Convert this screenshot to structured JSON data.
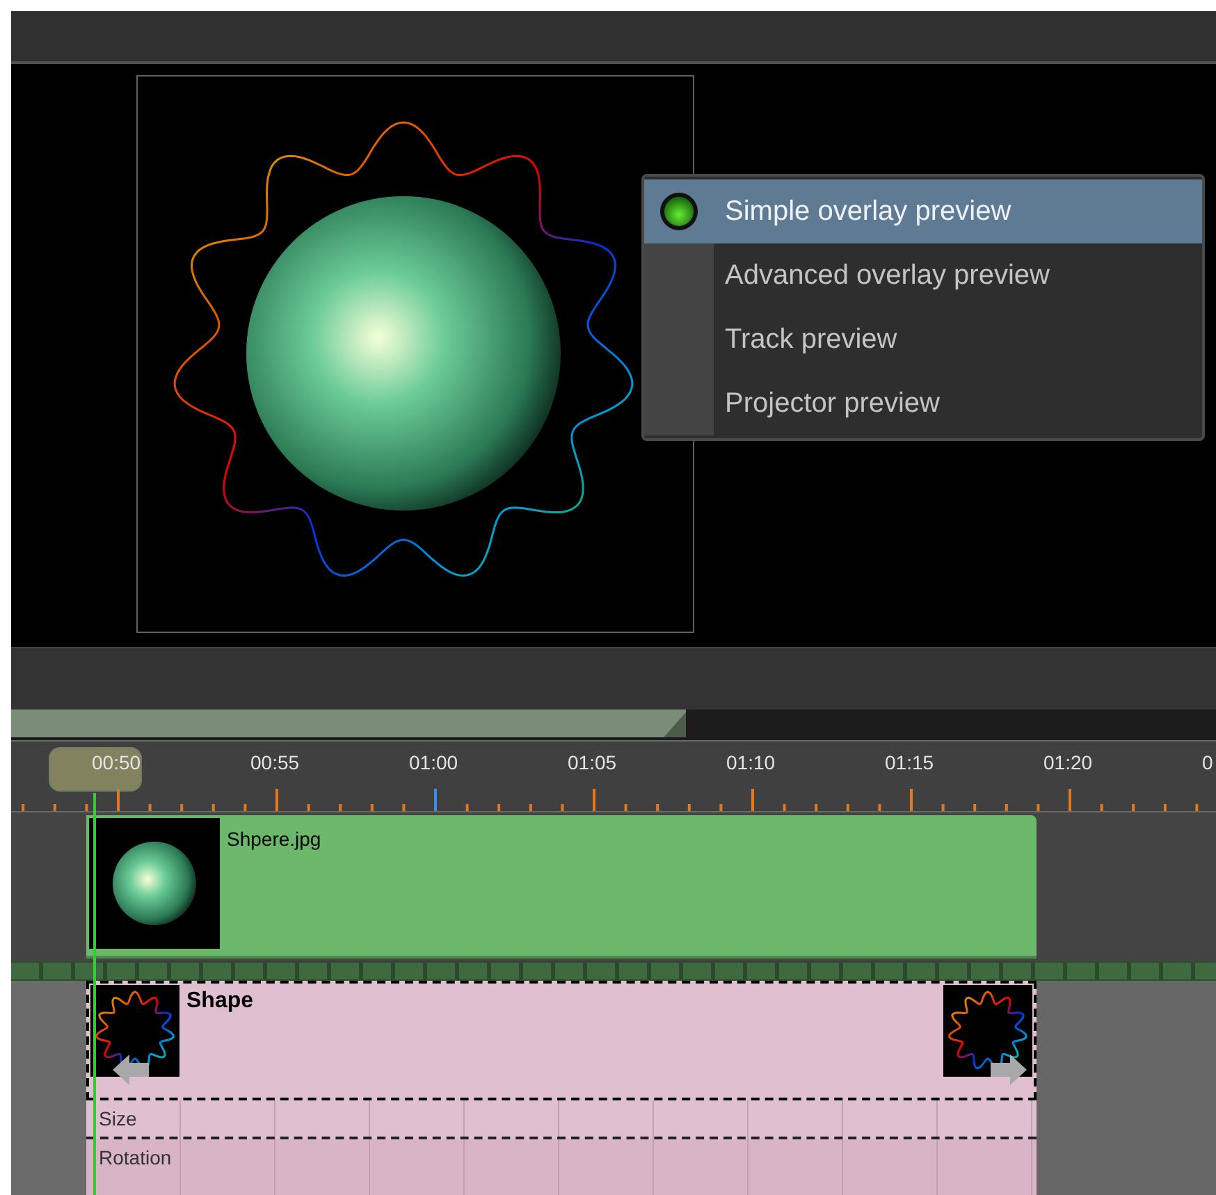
{
  "preview_menu": [
    {
      "label": "Simple overlay preview",
      "selected": true
    },
    {
      "label": "Advanced overlay preview",
      "selected": false
    },
    {
      "label": "Track preview",
      "selected": false
    },
    {
      "label": "Projector preview",
      "selected": false
    }
  ],
  "scrollbar": {
    "level": 0.56
  },
  "ruler": {
    "labels": [
      "00:50",
      "00:55",
      "01:00",
      "01:05",
      "01:10",
      "01:15",
      "01:20",
      "0"
    ]
  },
  "clips": [
    {
      "name": "Shpere.jpg"
    },
    {
      "kind": "shape",
      "name": "Shape",
      "parameters": [
        "Size",
        "Rotation"
      ]
    }
  ]
}
